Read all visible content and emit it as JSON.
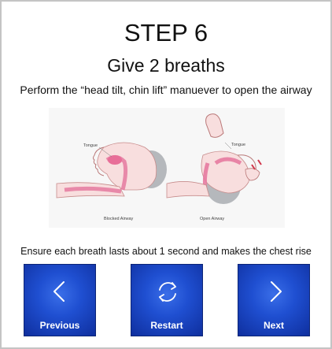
{
  "step": {
    "title": "STEP 6",
    "subtitle": "Give 2 breaths",
    "instruction": "Perform the “head tilt, chin lift” manuever to open the airway",
    "caption": "Ensure each breath lasts about 1 second and makes the chest rise"
  },
  "illustration": {
    "left_label": "Tongue",
    "right_label": "Tongue",
    "left_caption": "Blocked Airway",
    "right_caption": "Open Airway"
  },
  "navigation": {
    "previous_label": "Previous",
    "restart_label": "Restart",
    "next_label": "Next",
    "previous_icon": "chevron-left-icon",
    "restart_icon": "refresh-icon",
    "next_icon": "chevron-right-icon"
  },
  "colors": {
    "button_blue": "#1f4fd1",
    "airway_pink": "#ee8fb0",
    "border_gray": "#c4c4c4"
  }
}
